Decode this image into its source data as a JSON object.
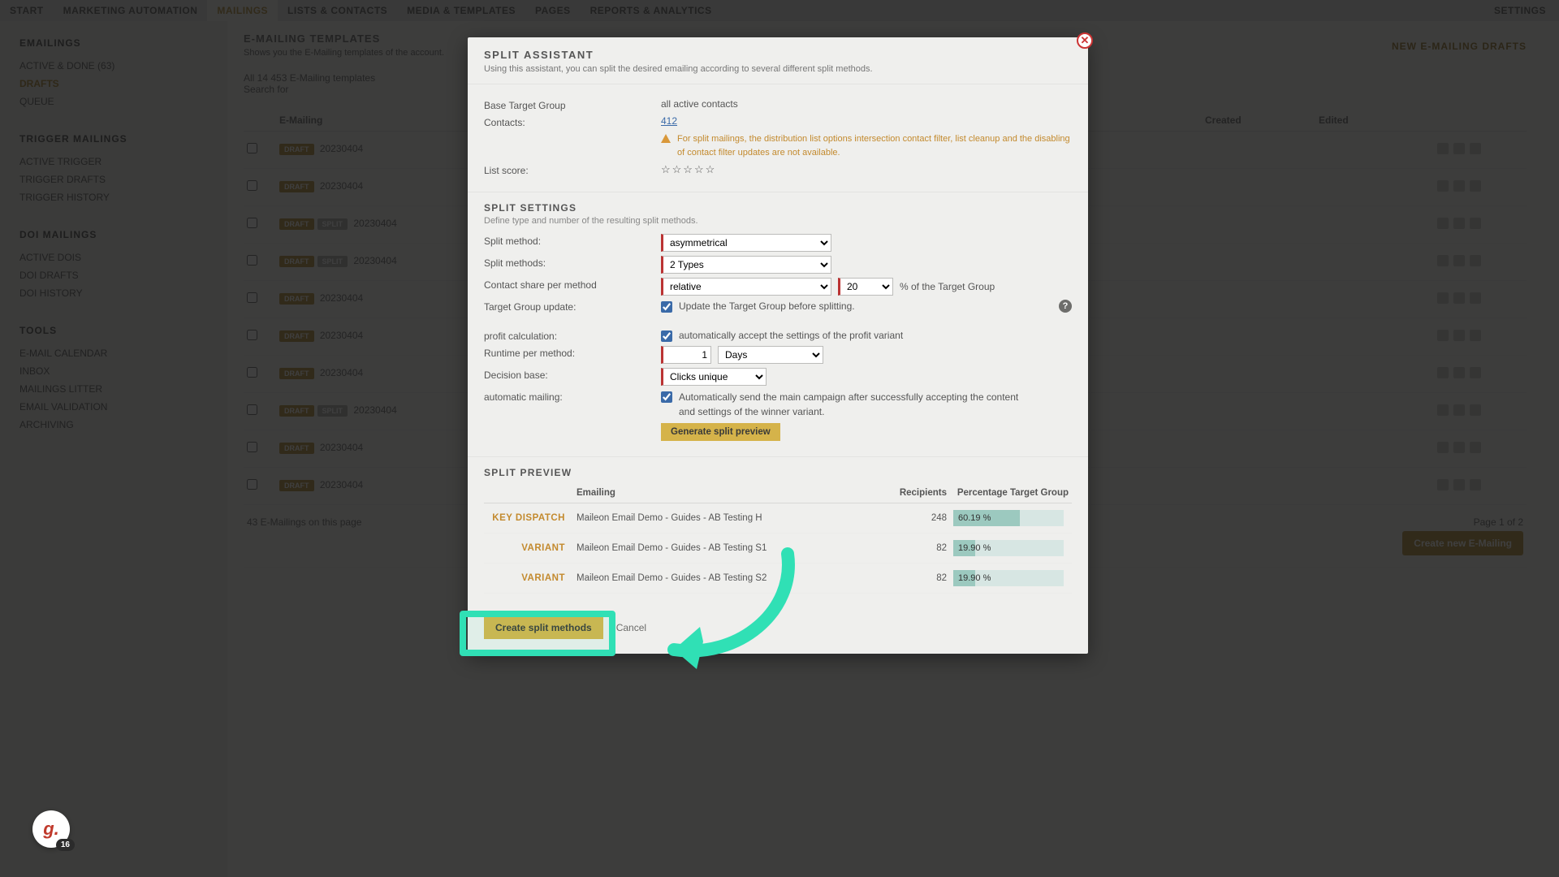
{
  "topnav": {
    "items": [
      "START",
      "MARKETING AUTOMATION",
      "MAILINGS",
      "LISTS & CONTACTS",
      "MEDIA & TEMPLATES",
      "PAGES",
      "REPORTS & ANALYTICS"
    ],
    "active_index": 2,
    "right": "SETTINGS"
  },
  "sidebar": {
    "groups": [
      {
        "title": "EMAILINGS",
        "items": [
          "ACTIVE & DONE (63)",
          "DRAFTS",
          "QUEUE"
        ],
        "active_index": 1
      },
      {
        "title": "TRIGGER MAILINGS",
        "items": [
          "ACTIVE TRIGGER",
          "TRIGGER DRAFTS",
          "TRIGGER HISTORY"
        ]
      },
      {
        "title": "DOI MAILINGS",
        "items": [
          "ACTIVE DOIS",
          "DOI DRAFTS",
          "DOI HISTORY"
        ]
      },
      {
        "title": "TOOLS",
        "items": [
          "E-MAIL CALENDAR",
          "INBOX",
          "MAILINGS LITTER",
          "EMAIL VALIDATION",
          "ARCHIVING"
        ]
      }
    ]
  },
  "main": {
    "title": "E-MAILING TEMPLATES",
    "subtitle": "Shows you the E-Mailing templates of the account.",
    "draft_button": "NEW E-MAILING DRAFTS",
    "filter_line_a": "All 14 453 E-Mailing templates",
    "filter_line_b": "Search for",
    "columns": [
      "",
      "E-Mailing",
      "Created",
      "Edited",
      ""
    ],
    "rows": [
      {
        "badges": [
          "DRAFT"
        ],
        "date": "20230404"
      },
      {
        "badges": [
          "DRAFT"
        ],
        "date": "20230404"
      },
      {
        "badges": [
          "DRAFT",
          "SPLIT"
        ],
        "date": "20230404"
      },
      {
        "badges": [
          "DRAFT",
          "SPLIT"
        ],
        "date": "20230404"
      },
      {
        "badges": [
          "DRAFT"
        ],
        "date": "20230404"
      },
      {
        "badges": [
          "DRAFT"
        ],
        "date": "20230404"
      },
      {
        "badges": [
          "DRAFT"
        ],
        "date": "20230404"
      },
      {
        "badges": [
          "DRAFT",
          "SPLIT"
        ],
        "date": "20230404"
      },
      {
        "badges": [
          "DRAFT"
        ],
        "date": "20230404"
      },
      {
        "badges": [
          "DRAFT"
        ],
        "date": "20230404"
      }
    ],
    "footer_count": "43 E-Mailings on this page",
    "pager": "Page 1 of 2",
    "new_button": "Create new E-Mailing"
  },
  "modal": {
    "title": "SPLIT ASSISTANT",
    "subtitle": "Using this assistant, you can split the desired emailing according to several different split methods.",
    "base_target_label": "Base Target Group",
    "base_target_value": "all active contacts",
    "contacts_label": "Contacts:",
    "contacts_value": "412",
    "warning": "For split mailings, the distribution list options intersection contact filter, list cleanup and the disabling of contact filter updates are not available.",
    "list_score_label": "List score:",
    "settings_title": "SPLIT SETTINGS",
    "settings_sub": "Define type and number of the resulting split methods.",
    "split_method_label": "Split method:",
    "split_method_value": "asymmetrical",
    "split_methods_label": "Split methods:",
    "split_methods_value": "2 Types",
    "contact_share_label": "Contact share per method",
    "contact_share_value": "relative",
    "contact_share_pct": "20",
    "contact_share_suffix": "% of the Target Group",
    "tg_update_label": "Target Group update:",
    "tg_update_text": "Update the Target Group before splitting.",
    "profit_label": "profit calculation:",
    "profit_text": "automatically accept the settings of the profit variant",
    "runtime_label": "Runtime per method:",
    "runtime_value": "1",
    "runtime_unit": "Days",
    "decision_label": "Decision base:",
    "decision_value": "Clicks unique",
    "auto_mailing_label": "automatic mailing:",
    "auto_mailing_text": "Automatically send the main campaign after successfully accepting the content and settings of the winner variant.",
    "gen_button": "Generate split preview",
    "preview_title": "SPLIT PREVIEW",
    "preview_cols": [
      "",
      "Emailing",
      "Recipients",
      "Percentage Target Group"
    ],
    "preview_rows": [
      {
        "tag": "KEY DISPATCH",
        "name": "Maileon Email Demo - Guides - AB Testing H",
        "recipients": "248",
        "pct": "60.19 %",
        "fill": 60.19
      },
      {
        "tag": "VARIANT",
        "name": "Maileon Email Demo - Guides - AB Testing S1",
        "recipients": "82",
        "pct": "19.90 %",
        "fill": 19.9
      },
      {
        "tag": "VARIANT",
        "name": "Maileon Email Demo - Guides - AB Testing S2",
        "recipients": "82",
        "pct": "19.90 %",
        "fill": 19.9
      }
    ],
    "create_button": "Create split methods",
    "cancel": "Cancel"
  },
  "gbadge": {
    "letter": "g.",
    "count": "16"
  }
}
